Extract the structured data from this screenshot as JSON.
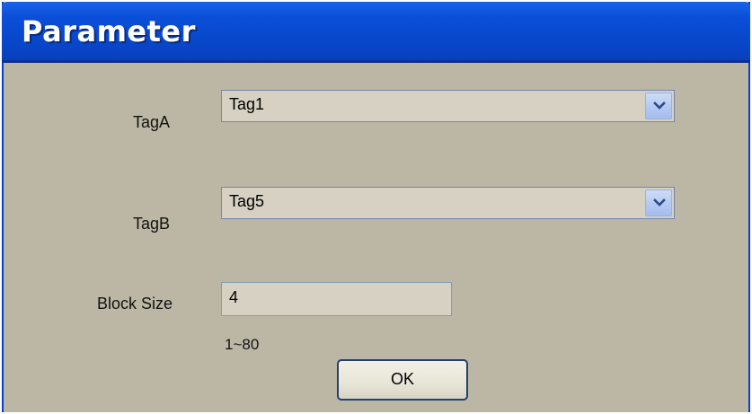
{
  "window": {
    "title": "Parameter"
  },
  "fields": {
    "tag_a": {
      "label": "TagA",
      "value": "Tag1"
    },
    "tag_b": {
      "label": "TagB",
      "value": "Tag5"
    },
    "block_size": {
      "label": "Block Size",
      "value": "4",
      "range_hint": "1~80"
    }
  },
  "buttons": {
    "ok_label": "OK"
  },
  "icons": {
    "dropdown": "chevron-down-icon"
  },
  "colors": {
    "titlebar": "#0a4fd8",
    "dialog_background": "#bcb7a4",
    "field_background": "#d6d1c2",
    "dropdown_button": "#b6cbf3",
    "ok_border": "#24406e"
  }
}
